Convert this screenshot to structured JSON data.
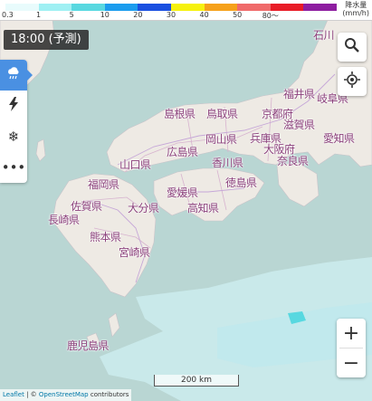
{
  "legend": {
    "unit": "降水量",
    "unit_sub": "(mm/h)",
    "colors": [
      "#e8fbfc",
      "#9ff0f3",
      "#58d8e0",
      "#1b9cee",
      "#1a4fe0",
      "#f6f10d",
      "#f6a11a",
      "#f06a6a",
      "#e81c27",
      "#8e1da0"
    ],
    "ticks": [
      "0.3",
      "1",
      "5",
      "10",
      "20",
      "30",
      "40",
      "50",
      "80～"
    ]
  },
  "time": {
    "label": "18:00 (予測)"
  },
  "layers": {
    "items": [
      {
        "name": "rain",
        "icon": "rain-cloud-icon",
        "active": true
      },
      {
        "name": "lightning",
        "icon": "lightning-icon",
        "active": false
      },
      {
        "name": "snow",
        "icon": "snowflake-icon",
        "active": false
      },
      {
        "name": "more",
        "icon": "more-icon",
        "active": false
      }
    ]
  },
  "prefectures": {
    "ishikawa": "石川",
    "fukui": "福井県",
    "gifu": "岐阜県",
    "shimane": "島根県",
    "tottori": "鳥取県",
    "kyoto": "京都府",
    "shiga": "滋賀県",
    "okayama": "岡山県",
    "aichi": "愛知県",
    "hiroshima": "広島県",
    "hyogo": "兵庫県",
    "osaka": "大阪府",
    "yamaguchi": "山口県",
    "kagawa": "香川県",
    "nara": "奈良県",
    "fukuoka": "福岡県",
    "ehime": "愛媛県",
    "tokushima": "徳島県",
    "saga": "佐賀県",
    "oita": "大分県",
    "kochi": "高知県",
    "nagasaki": "長崎県",
    "kumamoto": "熊本県",
    "miyazaki": "宮崎県",
    "kagoshima": "鹿児島県"
  },
  "zoom": {
    "in_label": "+",
    "out_label": "−"
  },
  "scale": {
    "label": "200 km"
  },
  "attribution": {
    "leaflet": "Leaflet",
    "separator": " | © ",
    "osm": "OpenStreetMap",
    "contributors": " contributors"
  }
}
